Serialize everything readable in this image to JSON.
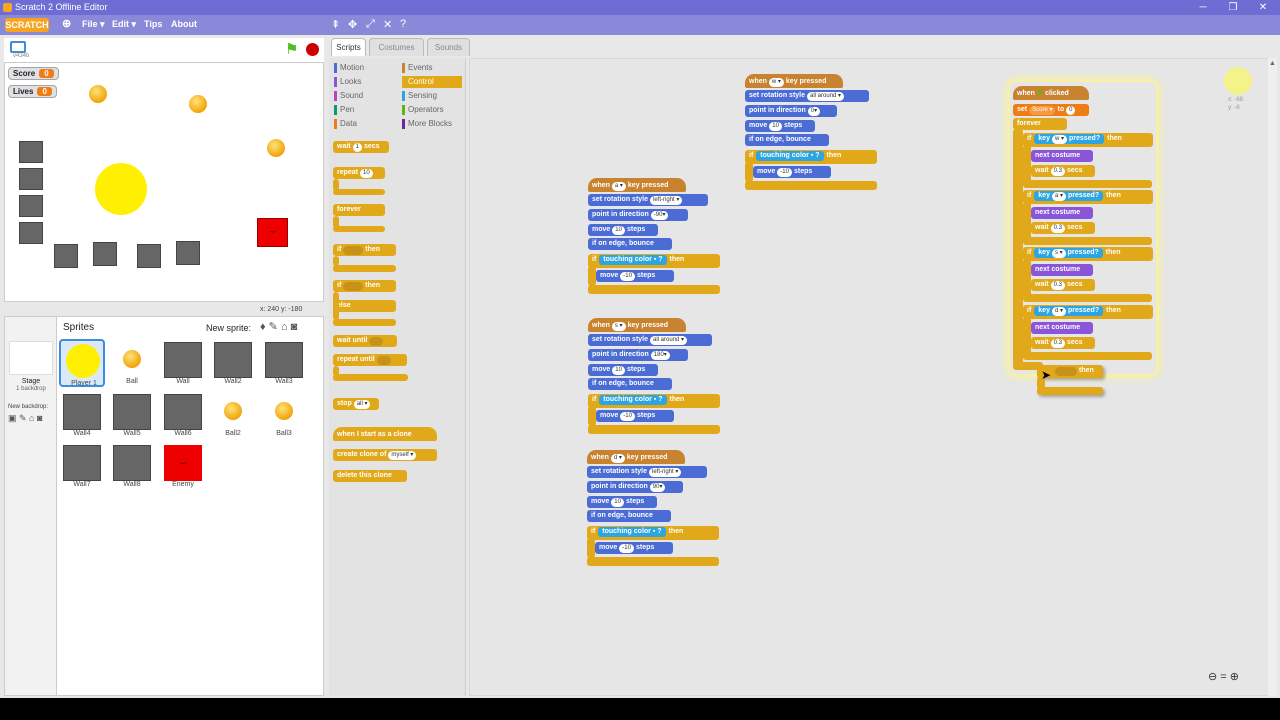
{
  "window": {
    "title": "Scratch 2 Offline Editor",
    "minimize": "─",
    "maximize": "❐",
    "close": "✕"
  },
  "menu": {
    "logo": "SCRATCH",
    "file": "File ▾",
    "edit": "Edit ▾",
    "tips": "Tips",
    "about": "About"
  },
  "stage": {
    "version": "v434b",
    "watchers": [
      {
        "label": "Score",
        "value": "0"
      },
      {
        "label": "Lives",
        "value": "0"
      }
    ],
    "coords": "x: 240  y: -180"
  },
  "sprites_pane": {
    "title": "Sprites",
    "new_sprite": "New sprite:",
    "stage_label": "Stage",
    "backdrop_count": "1 backdrop",
    "new_backdrop": "New backdrop:",
    "items": [
      "Player 1",
      "Ball",
      "Wall",
      "Wall2",
      "Wall3",
      "Wall4",
      "Wall5",
      "Wall6",
      "Ball2",
      "Ball3",
      "Wall7",
      "Wall8",
      "Enemy"
    ]
  },
  "tabs": [
    "Scripts",
    "Costumes",
    "Sounds"
  ],
  "categories": {
    "left": [
      "Motion",
      "Looks",
      "Sound",
      "Pen",
      "Data"
    ],
    "right": [
      "Events",
      "Control",
      "Sensing",
      "Operators",
      "More Blocks"
    ],
    "selected": "Control"
  },
  "palette": {
    "wait": "wait",
    "wait_arg": "1",
    "secs": "secs",
    "repeat": "repeat",
    "repeat_arg": "10",
    "forever": "forever",
    "if": "if",
    "then": "then",
    "else": "else",
    "wait_until": "wait until",
    "repeat_until": "repeat until",
    "stop": "stop",
    "stop_arg": "all ▾",
    "when_clone": "when I start as a clone",
    "create_clone": "create clone of",
    "create_clone_arg": "myself ▾",
    "delete_clone": "delete this clone"
  },
  "scripts": {
    "when": "when",
    "key_pressed": "key pressed",
    "set_rot": "set rotation style",
    "point_dir": "point in direction",
    "move": "move",
    "steps": "steps",
    "edge": "if on edge, bounce",
    "touching": "touching color",
    "q": "?",
    "if": "if",
    "then": "then",
    "s1": {
      "key": "a ▾",
      "rot": "left-right ▾",
      "dir": "-90▾",
      "move": "10",
      "move2": "-10"
    },
    "s2": {
      "key": "s ▾",
      "rot": "all around ▾",
      "dir": "180▾",
      "move": "10",
      "move2": "-10"
    },
    "s3": {
      "key": "d ▾",
      "rot": "left-right ▾",
      "dir": "90▾",
      "move": "10",
      "move2": "-10"
    },
    "s4": {
      "key": "w ▾",
      "rot": "all around ▾",
      "dir": "0▾",
      "move": "10",
      "move2": "-10"
    },
    "flag": {
      "clicked": "clicked",
      "set": "set",
      "var": "Score ▾",
      "to": "to",
      "to_val": "0",
      "forever": "forever",
      "key": "key",
      "pressed": "pressed?",
      "next_costume": "next costume",
      "wait": "wait",
      "wait_val": "0.3",
      "secs": "secs",
      "keys": [
        "w ▾",
        "a ▾",
        "s ▾",
        "d ▾"
      ]
    },
    "drag_then": "then",
    "sprite_pos": {
      "x": "x: -68",
      "y": "y: -6"
    }
  },
  "colors": {
    "control": "#e1a91a",
    "motion": "#4a6cd4",
    "looks": "#8a55d7",
    "events": "#c88330",
    "sensing": "#2ca5e2"
  }
}
